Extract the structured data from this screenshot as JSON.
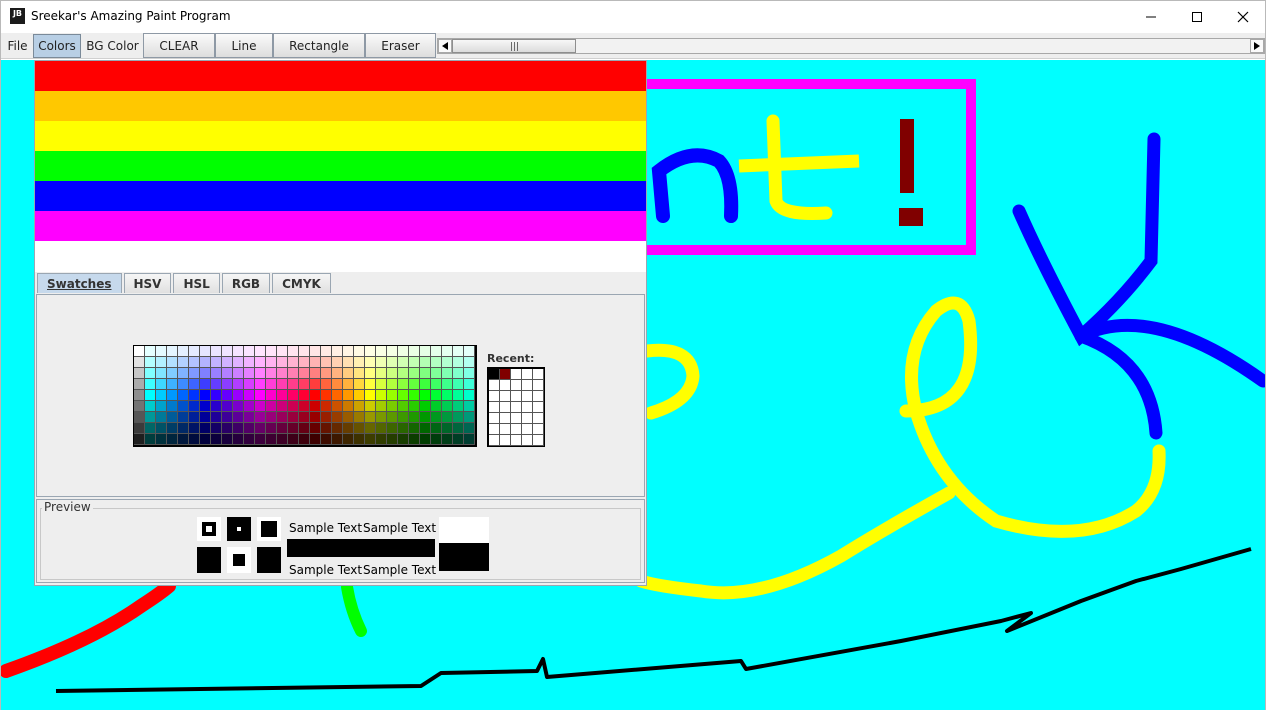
{
  "window": {
    "title": "Sreekar's Amazing Paint Program",
    "icon_text": "JB",
    "icon_name": "java-app-icon",
    "controls": [
      "minimize-icon",
      "maximize-icon",
      "close-icon"
    ]
  },
  "toolbar": {
    "menus": {
      "file": "File",
      "colors": "Colors",
      "bg_color": "BG Color"
    },
    "buttons": {
      "clear": "CLEAR",
      "line": "Line",
      "rectangle": "Rectangle",
      "eraser": "Eraser"
    },
    "scrollbar": {
      "icons": [
        "scroll-left-arrow-icon",
        "scroll-right-arrow-icon"
      ]
    }
  },
  "color_chooser": {
    "color_list": [
      "#ff0000",
      "#ffc800",
      "#ffff00",
      "#00ff00",
      "#0000ff",
      "#ff00ff",
      "#ffffff"
    ],
    "tabs": [
      {
        "label": "Swatches",
        "active": true
      },
      {
        "label": "HSV",
        "active": false
      },
      {
        "label": "HSL",
        "active": false
      },
      {
        "label": "RGB",
        "active": false
      },
      {
        "label": "CMYK",
        "active": false
      }
    ],
    "recent_label": "Recent:",
    "recent_colors": [
      "#000000",
      "#800000"
    ],
    "preview": {
      "label": "Preview",
      "sample_text": "Sample Text"
    }
  },
  "canvas": {
    "background": "#00ffff",
    "painted_text": "nt!"
  }
}
